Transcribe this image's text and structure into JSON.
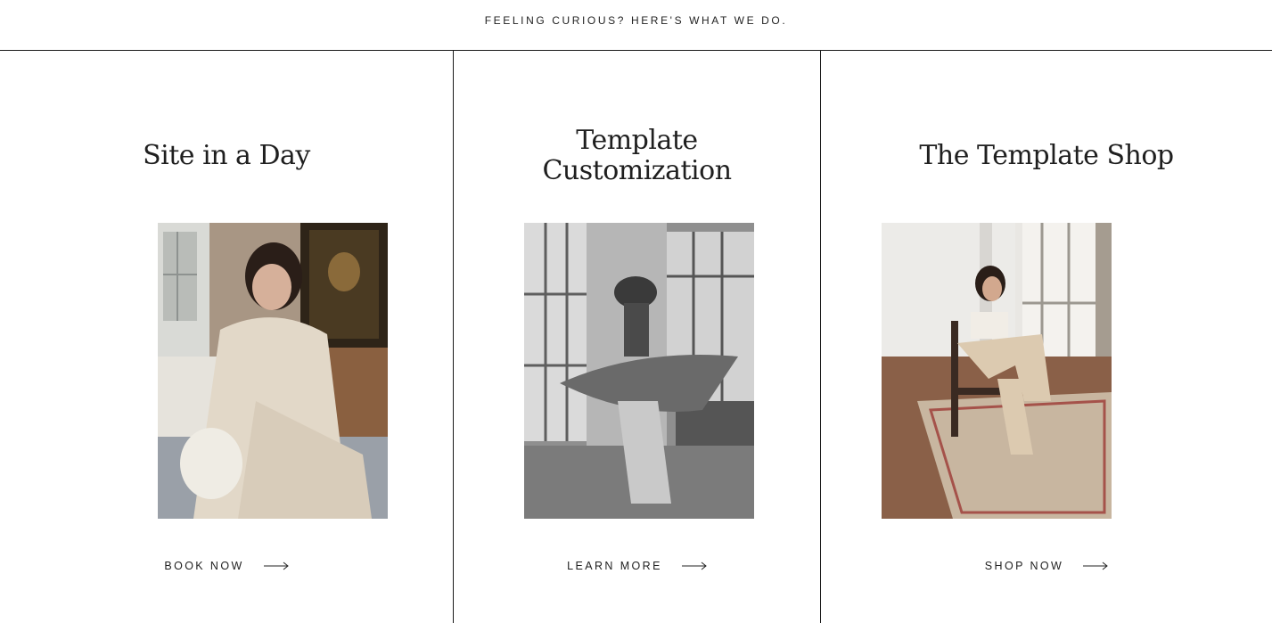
{
  "header": {
    "tagline": "FEELING CURIOUS? HERE'S WHAT WE DO."
  },
  "services": [
    {
      "title": "Site in a Day",
      "image": "woman seated by window in linen outfit",
      "cta_label": "BOOK NOW",
      "cta_icon": "arrow-right-icon"
    },
    {
      "title_line1": "Template",
      "title_line2": "Customization",
      "image": "black and white woman twirling in studio",
      "cta_label": "LEARN MORE",
      "cta_icon": "arrow-right-icon"
    },
    {
      "title": "The Template Shop",
      "image": "woman sitting on wooden chair on rug",
      "cta_label": "SHOP NOW",
      "cta_icon": "arrow-right-icon"
    }
  ],
  "colors": {
    "text": "#1a1a1a",
    "background": "#ffffff",
    "rule": "#1a1a1a"
  }
}
